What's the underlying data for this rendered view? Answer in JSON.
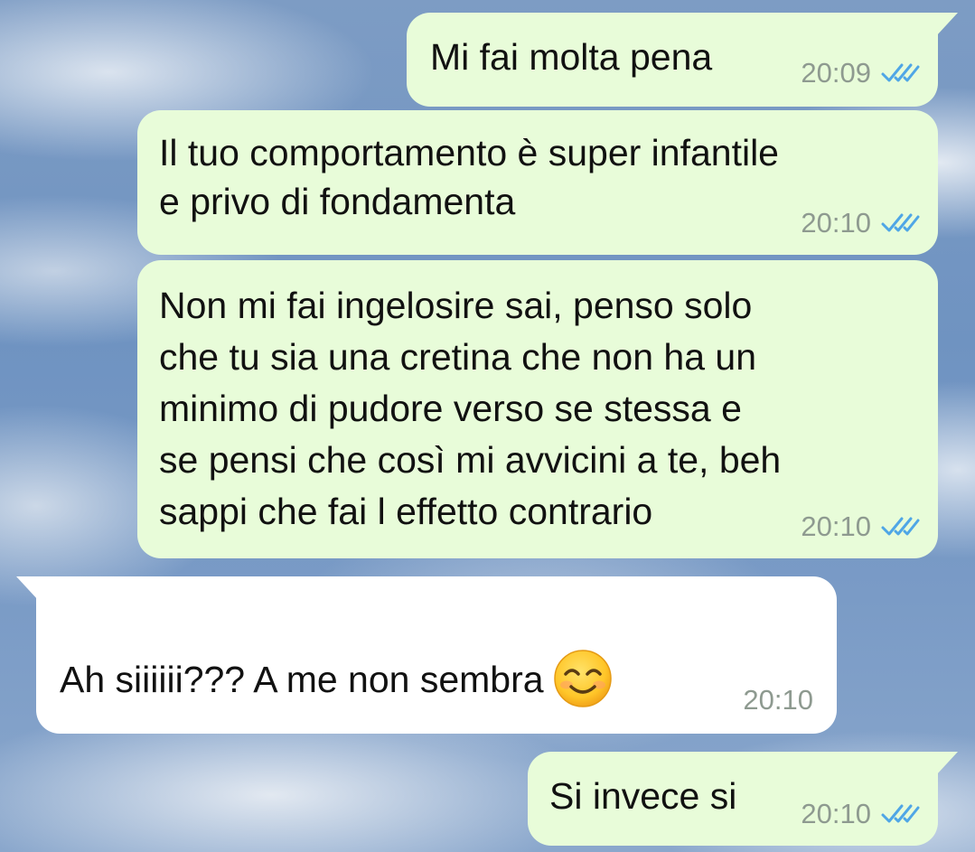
{
  "messages": [
    {
      "direction": "outgoing",
      "text": "Mi fai molta pena",
      "time": "20:09",
      "status_icon": "double-check-icon"
    },
    {
      "direction": "outgoing",
      "text": "Il tuo comportamento è super infantile\ne privo di fondamenta",
      "time": "20:10",
      "status_icon": "double-check-icon"
    },
    {
      "direction": "outgoing",
      "text": "Non mi fai ingelosire sai, penso solo\nche tu sia una cretina che non ha un\nminimo di pudore verso se stessa e\nse pensi che così mi avvicini a te, beh\nsappi che fai l effetto contrario",
      "time": "20:10",
      "status_icon": "double-check-icon"
    },
    {
      "direction": "incoming",
      "text": "Ah siiiiii??? A me non sembra",
      "emoji": "smiling-face-emoji",
      "time": "20:10"
    },
    {
      "direction": "outgoing",
      "text": "Si invece si",
      "time": "20:10",
      "status_icon": "double-check-icon"
    }
  ],
  "colors": {
    "outgoing_bubble": "#e8fcd9",
    "incoming_bubble": "#ffffff",
    "timestamp": "#8e9a90",
    "read_ticks": "#4fa6e6"
  }
}
